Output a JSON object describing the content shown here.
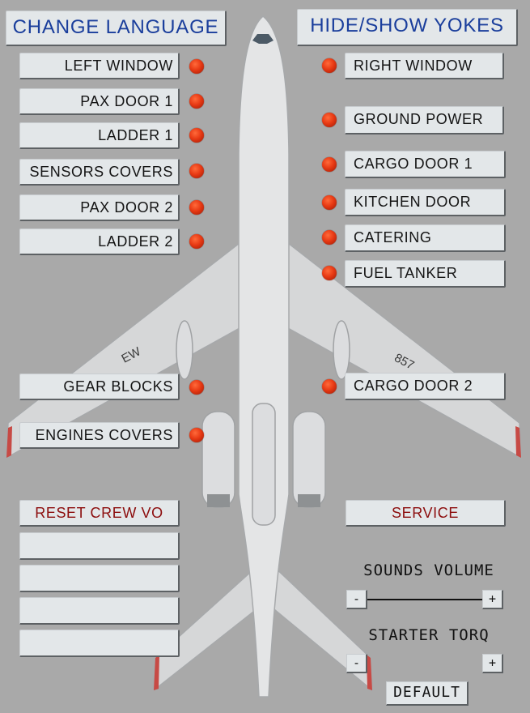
{
  "header": {
    "change_language": "CHANGE LANGUAGE",
    "hide_show_yokes": "HIDE/SHOW YOKES"
  },
  "left_toggles": [
    {
      "label": "LEFT WINDOW"
    },
    {
      "label": "PAX DOOR 1"
    },
    {
      "label": "LADDER 1"
    },
    {
      "label": "SENSORS COVERS"
    },
    {
      "label": "PAX DOOR 2"
    },
    {
      "label": "LADDER 2"
    },
    {
      "label": "GEAR BLOCKS"
    },
    {
      "label": "ENGINES COVERS"
    }
  ],
  "right_toggles": [
    {
      "label": "RIGHT WINDOW"
    },
    {
      "label": "GROUND POWER"
    },
    {
      "label": "CARGO DOOR 1"
    },
    {
      "label": "KITCHEN DOOR"
    },
    {
      "label": "CATERING"
    },
    {
      "label": "FUEL TANKER"
    },
    {
      "label": "CARGO DOOR 2"
    }
  ],
  "actions": {
    "reset_crew_vo": "RESET CREW VO",
    "service": "SERVICE",
    "empty_slots": [
      "",
      "",
      "",
      ""
    ]
  },
  "sounds_volume": {
    "label": "SOUNDS VOLUME",
    "minus": "-",
    "plus": "+"
  },
  "starter_torq": {
    "label": "STARTER TORQ",
    "minus": "-",
    "plus": "+"
  },
  "default_button": "DEFAULT",
  "aircraft_markings": {
    "left_wing": "EW",
    "right_wing": "857"
  },
  "colors": {
    "background": "#a9a9a9",
    "indicator_on": "#e83a14",
    "title_text": "#1a3e9c",
    "action_text": "#8c0d0d"
  }
}
